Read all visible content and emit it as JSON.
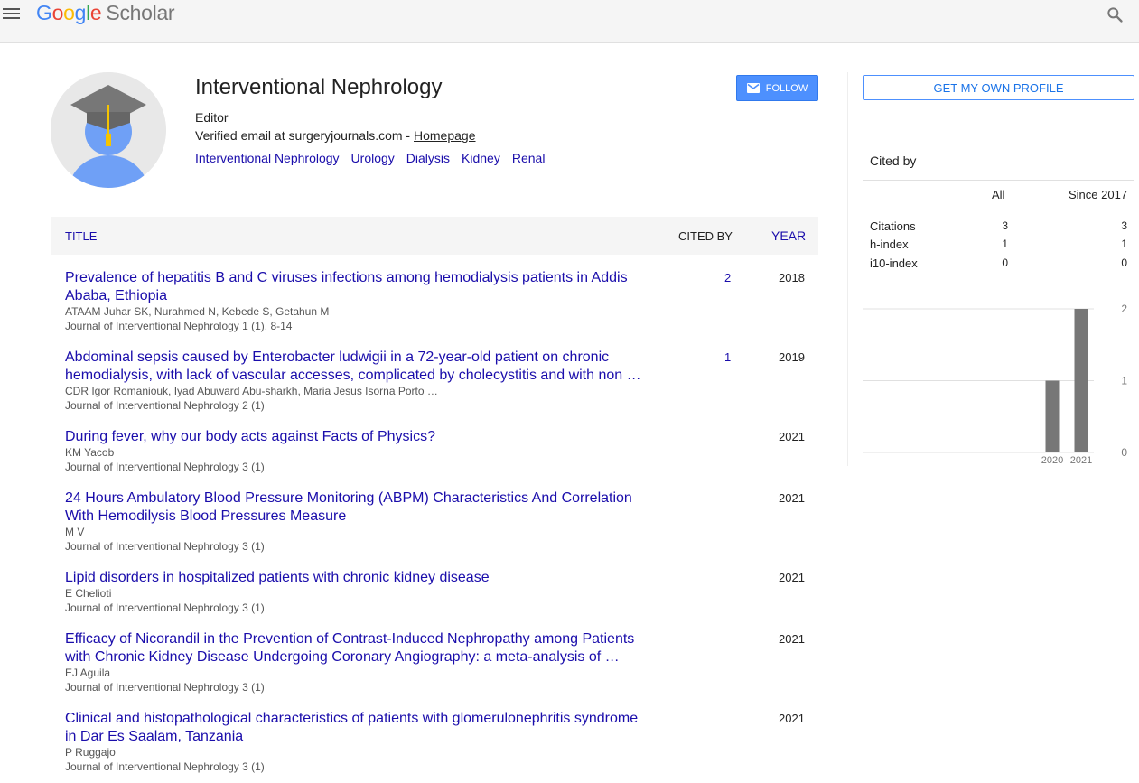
{
  "header": {
    "logo_google": [
      "G",
      "o",
      "o",
      "g",
      "l",
      "e"
    ],
    "logo_scholar": "Scholar"
  },
  "profile": {
    "name": "Interventional Nephrology",
    "affiliation": "Editor",
    "email_text": "Verified email at surgeryjournals.com - ",
    "homepage_label": "Homepage",
    "interests": [
      "Interventional Nephrology",
      "Urology",
      "Dialysis",
      "Kidney",
      "Renal"
    ],
    "follow_label": "Follow"
  },
  "table": {
    "col_title": "TITLE",
    "col_cited": "CITED BY",
    "col_year": "YEAR",
    "rows": [
      {
        "title": "Prevalence of hepatitis B and C viruses infections among hemodialysis patients in Addis Ababa, Ethiopia",
        "authors": "ATAAM Juhar SK, Nurahmed N, Kebede S, Getahun M",
        "venue": "Journal of Interventional Nephrology 1 (1), 8-14",
        "cited": "2",
        "year": "2018"
      },
      {
        "title": "Abdominal sepsis caused by Enterobacter ludwigii in a 72-year-old patient on chronic hemodialysis, with lack of vascular accesses, complicated by cholecystitis and with non …",
        "authors": "CDR Igor Romaniouk, Iyad Abuward Abu-sharkh, Maria Jesus Isorna Porto …",
        "venue": "Journal of Interventional Nephrology 2 (1)",
        "cited": "1",
        "year": "2019"
      },
      {
        "title": "During fever, why our body acts against Facts of Physics?",
        "authors": "KM Yacob",
        "venue": "Journal of Interventional Nephrology 3 (1)",
        "cited": "",
        "year": "2021"
      },
      {
        "title": "24 Hours Ambulatory Blood Pressure Monitoring (ABPM) Characteristics And Correlation With Hemodilysis Blood Pressures Measure",
        "authors": "M V",
        "venue": "Journal of Interventional Nephrology 3 (1)",
        "cited": "",
        "year": "2021"
      },
      {
        "title": "Lipid disorders in hospitalized patients with chronic kidney disease",
        "authors": "E Chelioti",
        "venue": "Journal of Interventional Nephrology 3 (1)",
        "cited": "",
        "year": "2021"
      },
      {
        "title": "Efficacy of Nicorandil in the Prevention of Contrast-Induced Nephropathy among Patients with Chronic Kidney Disease Undergoing Coronary Angiography: a meta-analysis of …",
        "authors": "EJ Aguila",
        "venue": "Journal of Interventional Nephrology 3 (1)",
        "cited": "",
        "year": "2021"
      },
      {
        "title": "Clinical and histopathological characteristics of patients with glomerulonephritis syndrome in Dar Es Saalam, Tanzania",
        "authors": "P Ruggajo",
        "venue": "Journal of Interventional Nephrology 3 (1)",
        "cited": "",
        "year": "2021"
      }
    ]
  },
  "sidebar": {
    "own_profile_label": "GET MY OWN PROFILE",
    "cited_by_heading": "Cited by",
    "col_all": "All",
    "col_since": "Since 2017",
    "stats": [
      {
        "label": "Citations",
        "all": "3",
        "since": "3"
      },
      {
        "label": "h-index",
        "all": "1",
        "since": "1"
      },
      {
        "label": "i10-index",
        "all": "0",
        "since": "0"
      }
    ]
  },
  "chart_data": {
    "type": "bar",
    "categories": [
      "2020",
      "2021"
    ],
    "values": [
      1,
      2
    ],
    "ylim": [
      0,
      2
    ],
    "yticks": [
      "0",
      "1",
      "2"
    ],
    "grid": true,
    "bar_color": "#777777"
  }
}
